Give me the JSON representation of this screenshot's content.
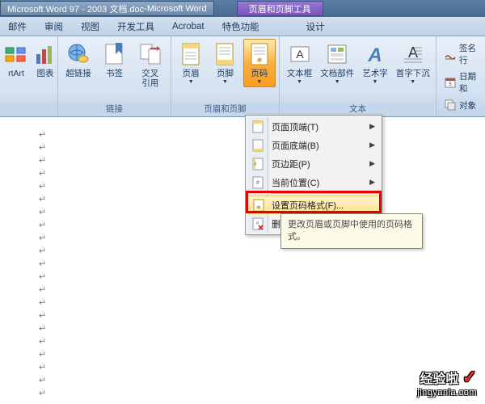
{
  "titlebar": {
    "doc_title": "Microsoft Word 97 - 2003 文档.doc",
    "separator": " - ",
    "app_name": "Microsoft Word",
    "tool_tab": "页眉和页脚工具"
  },
  "tabs": [
    "邮件",
    "审阅",
    "视图",
    "开发工具",
    "Acrobat",
    "特色功能",
    "设计"
  ],
  "ribbon": {
    "group1": {
      "label": "",
      "btn_art": "rtArt",
      "btn_chart": "图表"
    },
    "group2": {
      "label": "链接",
      "btn_hyperlink": "超链接",
      "btn_bookmark": "书签",
      "btn_crossref": "交叉\n引用"
    },
    "group3": {
      "label": "页眉和页脚",
      "btn_header": "页眉",
      "btn_footer": "页脚",
      "btn_pagenum": "页码"
    },
    "group4": {
      "label": "文本",
      "btn_textbox": "文本框",
      "btn_quickparts": "文档部件",
      "btn_wordart": "艺术字",
      "btn_dropcap": "首字下沉"
    },
    "group5": {
      "sig": "签名行",
      "date": "日期和",
      "obj": "对象 "
    }
  },
  "menu": {
    "items": [
      {
        "label": "页面顶端(T)",
        "arrow": true
      },
      {
        "label": "页面底端(B)",
        "arrow": true
      },
      {
        "label": "页边距(P)",
        "arrow": true
      },
      {
        "label": "当前位置(C)",
        "arrow": true
      }
    ],
    "format": "设置页码格式(F)...",
    "remove": "删除页码(R)"
  },
  "tooltip": "更改页眉或页脚中使用的页码格式。",
  "watermark": {
    "logo": "经验啦",
    "url": "jingyanla.com"
  }
}
